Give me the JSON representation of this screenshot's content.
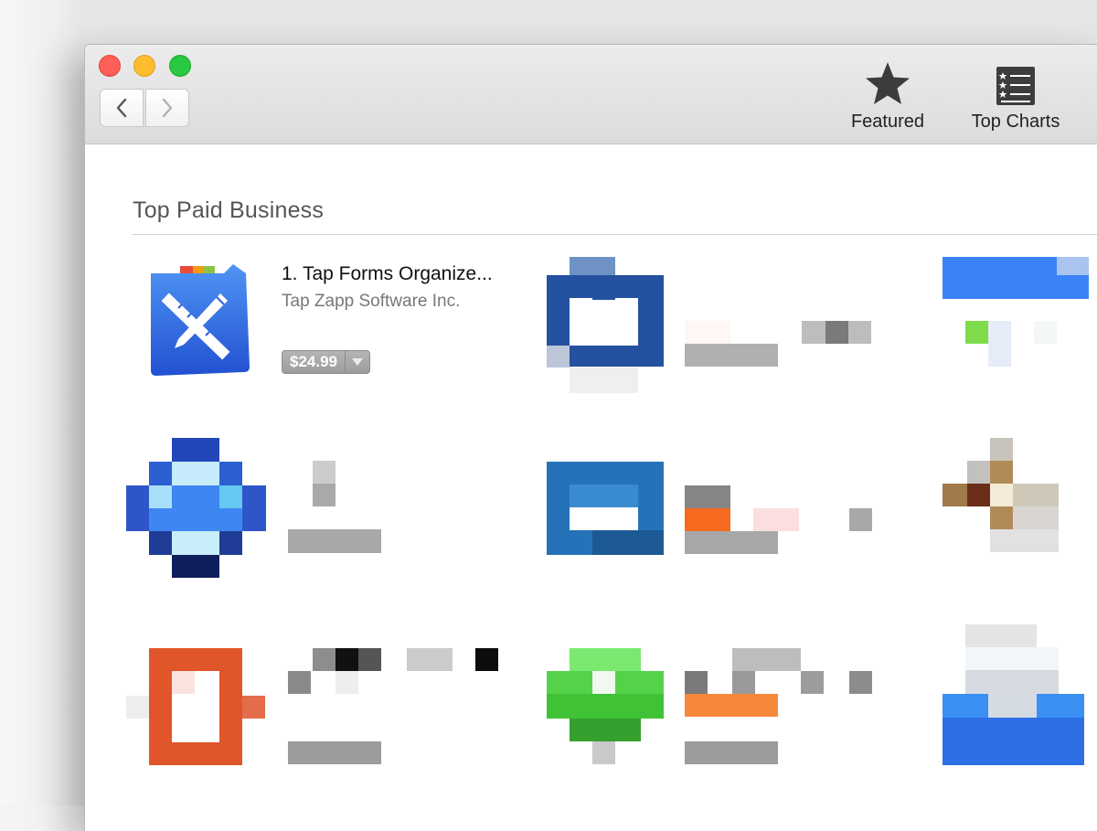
{
  "toolbar": {
    "featured_label": "Featured",
    "top_charts_label": "Top Charts"
  },
  "section": {
    "title": "Top Paid Business"
  },
  "apps": [
    {
      "rank_title": "1. Tap Forms Organize...",
      "developer": "Tap Zapp Software Inc.",
      "price": "$24.99",
      "icon": "tap-forms-icon"
    }
  ],
  "colors": {
    "close": "#fe5f57",
    "minimize": "#febc2e",
    "maximize": "#28c840",
    "app_icon_blue": "#2f6fe0"
  }
}
